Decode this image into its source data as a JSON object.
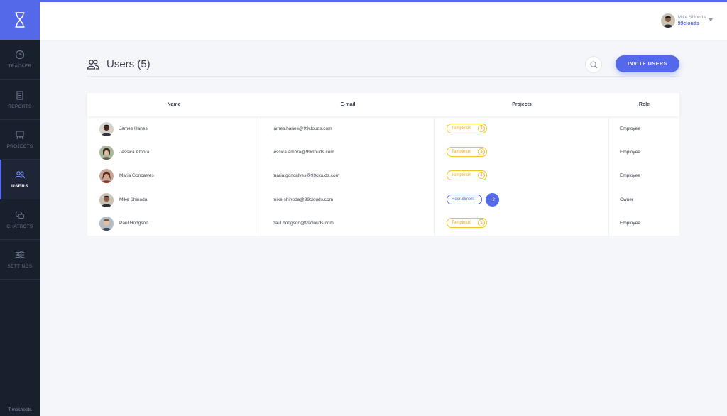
{
  "colors": {
    "accent": "#5468ea",
    "sidebar": "#181f2d",
    "project_yellow": "#f2c230"
  },
  "sidebar": {
    "logo_icon": "hourglass-icon",
    "items": [
      {
        "label": "TRACKER",
        "icon": "clock-icon",
        "active": false
      },
      {
        "label": "REPORTS",
        "icon": "clipboard-icon",
        "active": false
      },
      {
        "label": "PROJECTS",
        "icon": "easel-icon",
        "active": false
      },
      {
        "label": "USERS",
        "icon": "users-icon",
        "active": true
      },
      {
        "label": "CHATBOTS",
        "icon": "chat-icon",
        "active": false
      },
      {
        "label": "SETTINGS",
        "icon": "sliders-icon",
        "active": false
      }
    ],
    "footer": "Timesheets"
  },
  "topbar": {
    "user_name": "Mike Shinoda",
    "org_name": "99clouds"
  },
  "header": {
    "title": "Users (5)",
    "invite_label": "INVITE USERS"
  },
  "table": {
    "columns": [
      "Name",
      "E-mail",
      "Projects",
      "Role"
    ],
    "rows": [
      {
        "name": "James Hanes",
        "email": "james.hanes@99clouds.com",
        "project": "Templeton",
        "project_style": "yellow",
        "coin": "$",
        "extra": "",
        "role": "Employee"
      },
      {
        "name": "Jessica Amora",
        "email": "jessica.amora@99clouds.com",
        "project": "Templeton",
        "project_style": "yellow",
        "coin": "$",
        "extra": "",
        "role": "Employee"
      },
      {
        "name": "Maria Goncalves",
        "email": "maria.goncalves@99clouds.com",
        "project": "Templeton",
        "project_style": "yellow",
        "coin": "$",
        "extra": "",
        "role": "Employee"
      },
      {
        "name": "Mike Shinoda",
        "email": "mike.shinoda@99clouds.com",
        "project": "Recruitment",
        "project_style": "blue",
        "coin": "",
        "extra": "+2",
        "role": "Owner"
      },
      {
        "name": "Paul Hodgson",
        "email": "paul.hodgson@99clouds.com",
        "project": "Templeton",
        "project_style": "yellow",
        "coin": "$",
        "extra": "",
        "role": "Employee"
      }
    ]
  }
}
